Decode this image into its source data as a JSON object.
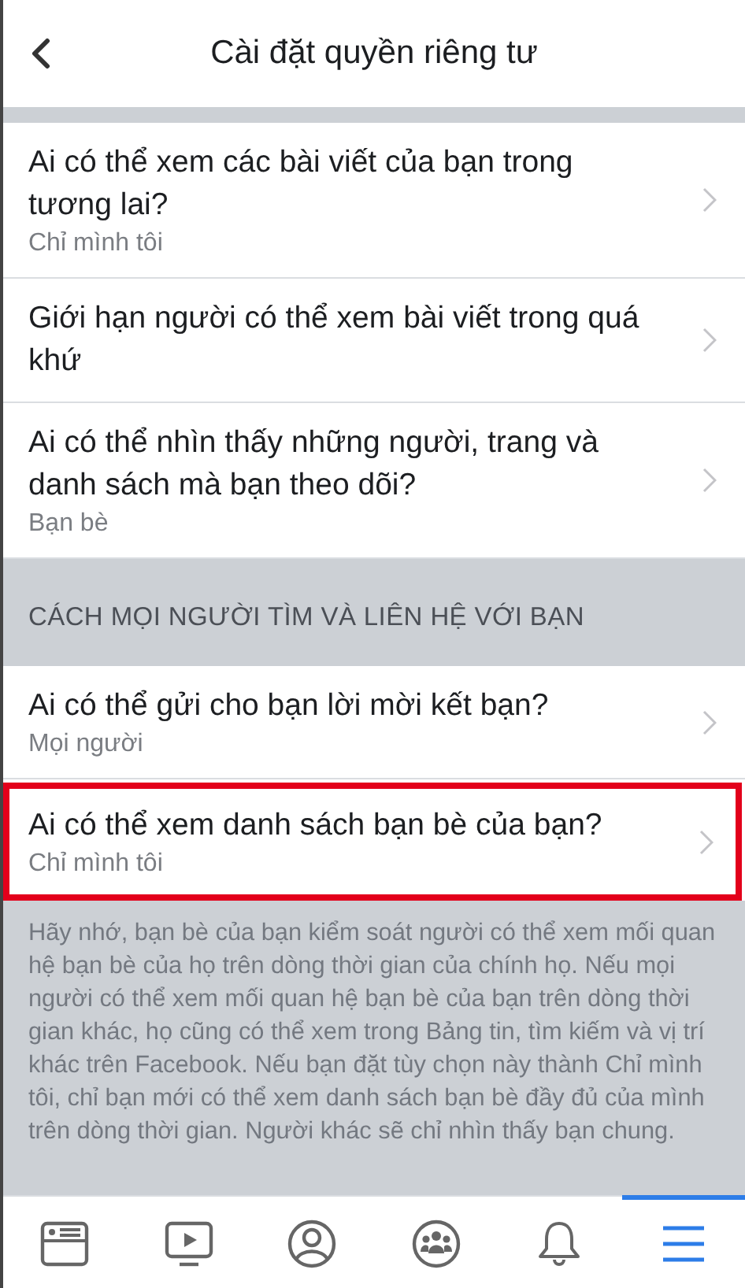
{
  "header": {
    "title": "Cài đặt quyền riêng tư"
  },
  "groups": [
    {
      "items": [
        {
          "title": "Ai có thể xem các bài viết của bạn trong tương lai?",
          "value": "Chỉ mình tôi",
          "highlighted": false
        },
        {
          "title": "Giới hạn người có thể xem bài viết trong quá khứ",
          "highlighted": false
        },
        {
          "title": "Ai có thể nhìn thấy những người, trang và danh sách mà bạn theo dõi?",
          "value": "Bạn bè",
          "highlighted": false
        }
      ]
    },
    {
      "heading": "CÁCH MỌI NGƯỜI TÌM VÀ LIÊN HỆ VỚI BẠN",
      "items": [
        {
          "title": "Ai có thể gửi cho bạn lời mời kết bạn?",
          "value": "Mọi người",
          "highlighted": false
        },
        {
          "title": "Ai có thể xem danh sách bạn bè của bạn?",
          "value": "Chỉ mình tôi",
          "highlighted": true
        }
      ],
      "note": "Hãy nhớ, bạn bè của bạn kiểm soát người có thể xem mối quan hệ bạn bè của họ trên dòng thời gian của chính họ. Nếu mọi người có thể xem mối quan hệ bạn bè của bạn trên dòng thời gian khác, họ cũng có thể xem trong Bảng tin, tìm kiếm và vị trí khác trên Facebook. Nếu bạn đặt tùy chọn này thành Chỉ mình tôi, chỉ bạn mới có thể xem danh sách bạn bè đầy đủ của mình trên dòng thời gian. Người khác sẽ chỉ nhìn thấy bạn chung."
    }
  ],
  "tab_bar": [
    {
      "kind": "feed",
      "selected": false
    },
    {
      "kind": "video",
      "selected": false
    },
    {
      "kind": "profile",
      "selected": false
    },
    {
      "kind": "groups",
      "selected": false
    },
    {
      "kind": "notifications",
      "selected": false
    },
    {
      "kind": "menu",
      "selected": true
    }
  ]
}
